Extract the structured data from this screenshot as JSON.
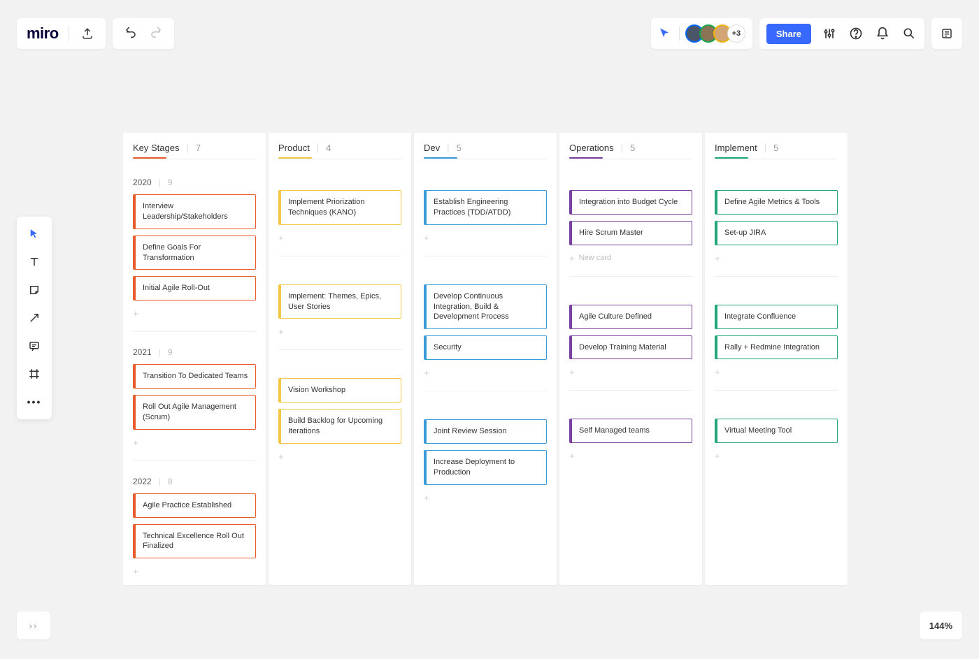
{
  "app": {
    "logo": "miro"
  },
  "header": {
    "share_label": "Share",
    "more_avatars": "+3"
  },
  "zoom": "144%",
  "new_card_label": "New card",
  "columns": [
    {
      "name": "Key Stages",
      "count": 7,
      "color": "#e85a2c"
    },
    {
      "name": "Product",
      "count": 4,
      "color": "#f2c744"
    },
    {
      "name": "Dev",
      "count": 5,
      "color": "#3a9bd9"
    },
    {
      "name": "Operations",
      "count": 5,
      "color": "#7b3fa0"
    },
    {
      "name": "Implement",
      "count": 5,
      "color": "#1fa67a"
    }
  ],
  "sections": [
    {
      "year": "2020",
      "count": 9
    },
    {
      "year": "2021",
      "count": 9
    },
    {
      "year": "2022",
      "count": 8
    }
  ],
  "cards": {
    "0": {
      "0": [
        "Interview Leadership/Stakeholders",
        "Define Goals For Transformation",
        "Initial Agile Roll-Out"
      ],
      "1": [
        "Transition To Dedicated Teams",
        "Roll Out Agile Management (Scrum)"
      ],
      "2": [
        "Agile Practice Established",
        "Technical Excellence Roll Out Finalized"
      ]
    },
    "1": {
      "0": [
        "Implement Priorization Techniques (KANO)"
      ],
      "1": [
        "Implement: Themes, Epics, User Stories"
      ],
      "2": [
        "Vision Workshop",
        "Build Backlog for Upcoming Iterations"
      ]
    },
    "2": {
      "0": [
        "Establish Engineering Practices (TDD/ATDD)"
      ],
      "1": [
        "Develop Continuous Integration, Build & Development Process",
        "Security"
      ],
      "2": [
        "Joint Review Session",
        "Increase Deployment to Production"
      ]
    },
    "3": {
      "0": [
        "Integration into Budget Cycle",
        "Hire Scrum Master"
      ],
      "1": [
        "Agile Culture Defined",
        "Develop Training Material"
      ],
      "2": [
        "Self Managed teams"
      ]
    },
    "4": {
      "0": [
        "Define Agile Metrics & Tools",
        "Set-up JIRA"
      ],
      "1": [
        "Integrate Confluence",
        "Rally + Redmine Integration"
      ],
      "2": [
        "Virtual Meeting Tool"
      ]
    }
  }
}
